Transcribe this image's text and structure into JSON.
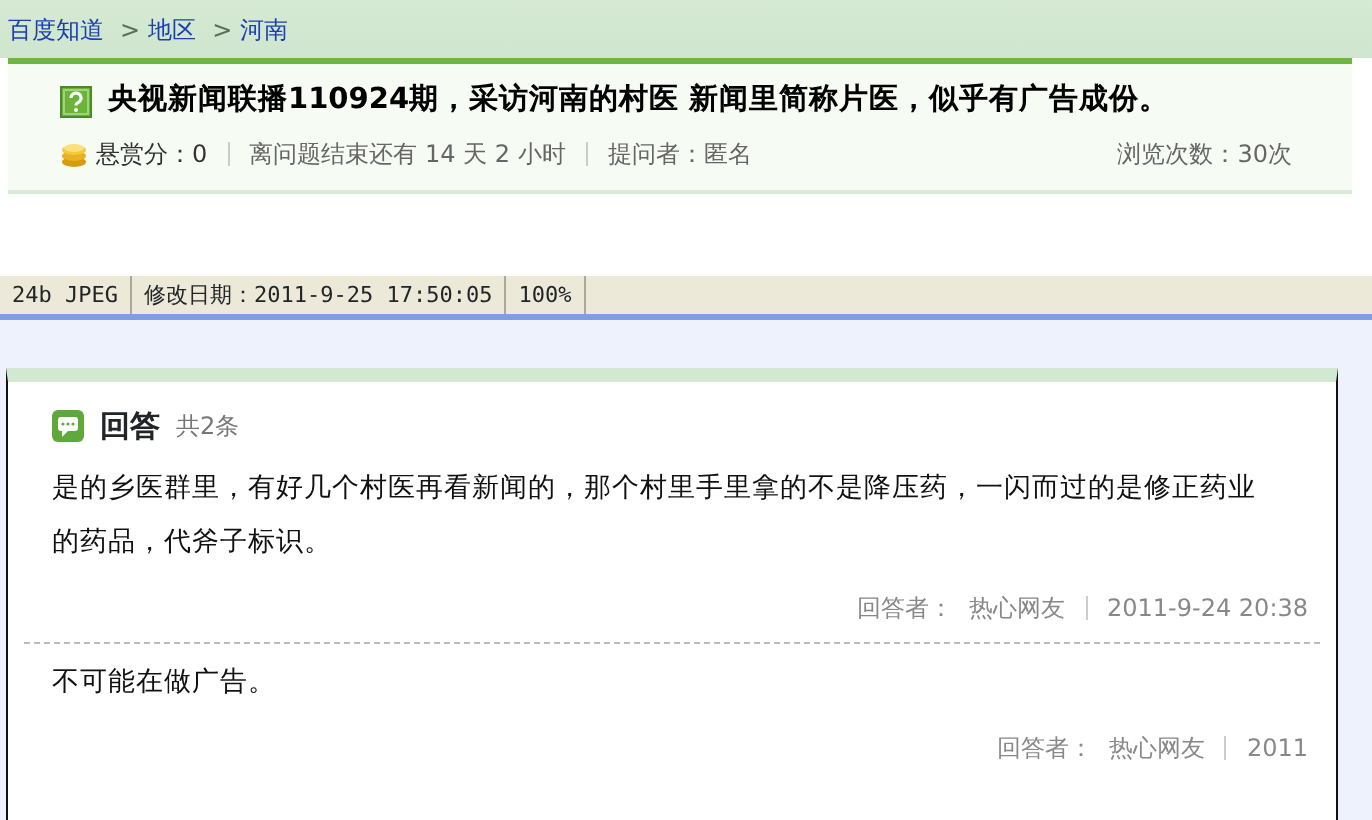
{
  "breadcrumb": [
    {
      "label": "百度知道"
    },
    {
      "label": "地区",
      "separator": ">"
    },
    {
      "label": "河南",
      "separator": ">"
    }
  ],
  "question": {
    "title": "央视新闻联播110924期，采访河南的村医  新闻里简称片医，似乎有广告成份。",
    "reward": "悬赏分：0",
    "remaining": "离问题结束还有 14 天 2 小时",
    "asker": "提问者：匿名",
    "views": "浏览次数：30次"
  },
  "status_bar": [
    "24b JPEG",
    "修改日期：2011-9-25 17:50:05",
    "100%"
  ],
  "answers": {
    "title": "回答",
    "count": "共2条",
    "items": [
      {
        "text": "是的乡医群里，有好几个村医再看新闻的，那个村里手里拿的不是降压药，一闪而过的是修正药业的药品，代斧子标识。",
        "answerer_label": "回答者：",
        "answerer": "热心网友",
        "time": "2011-9-24 20:38"
      },
      {
        "text": "不可能在做广告。",
        "answerer_label": "回答者：",
        "answerer": "热心网友",
        "time": "2011"
      }
    ]
  }
}
